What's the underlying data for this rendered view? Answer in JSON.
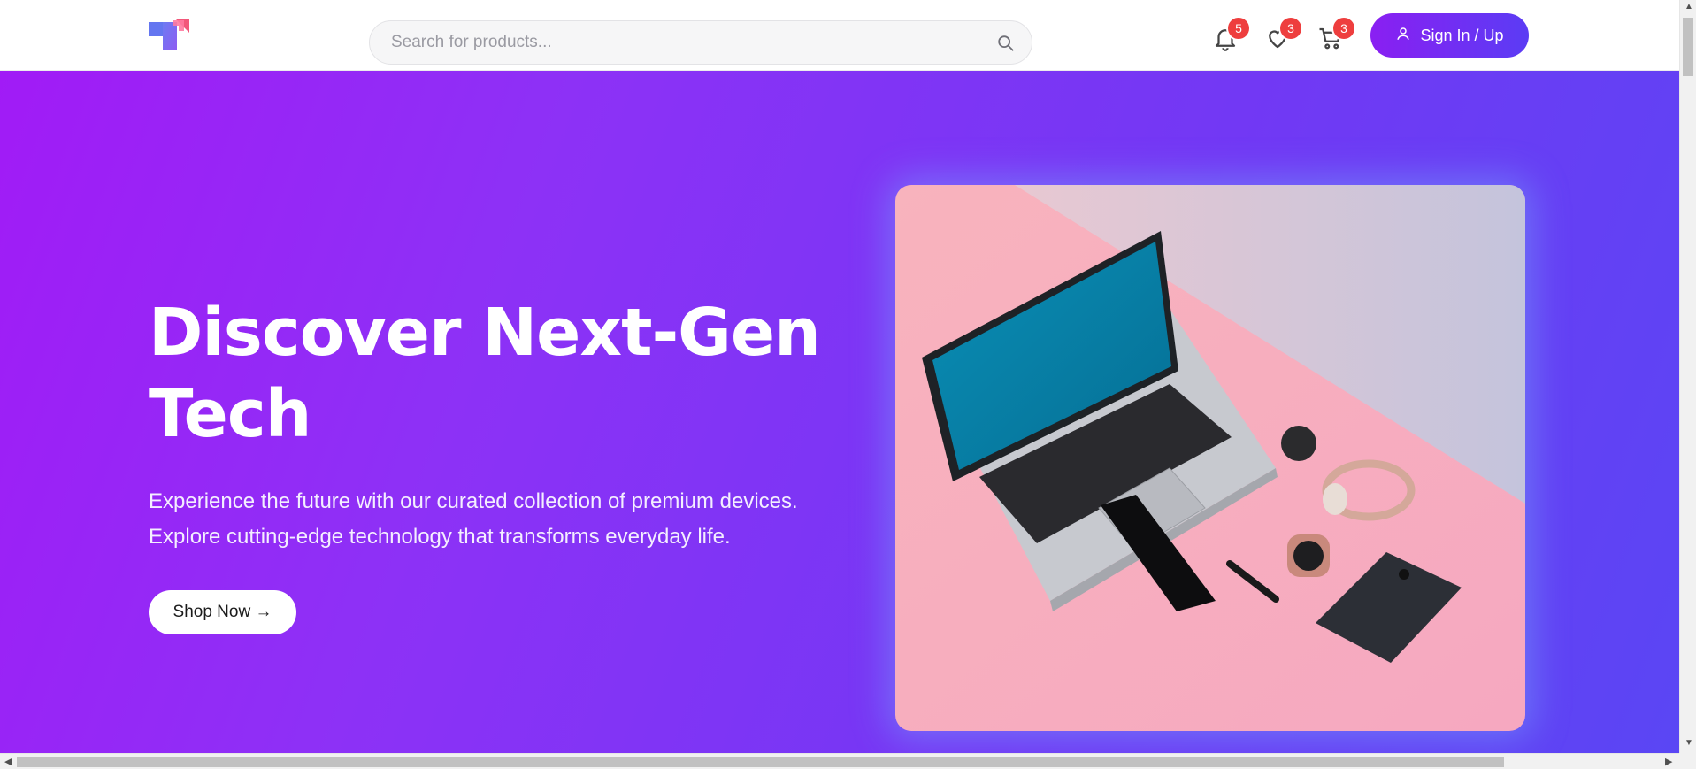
{
  "header": {
    "logo_icon": "brand-logo-icon",
    "search": {
      "placeholder": "Search for products...",
      "value": "",
      "icon": "search-icon"
    },
    "notifications": {
      "icon": "bell-icon",
      "count": "5"
    },
    "wishlist": {
      "icon": "heart-icon",
      "count": "3"
    },
    "cart": {
      "icon": "cart-icon",
      "count": "3"
    },
    "signin_label": "Sign In / Up",
    "signin_icon": "user-icon"
  },
  "hero": {
    "title": "Discover Next-Gen Tech",
    "description": "Experience the future with our curated collection of premium devices. Explore cutting-edge technology that transforms everyday life.",
    "cta_label": "Shop Now →",
    "image": "product-photo-laptop-phones-watch-headphones"
  },
  "colors": {
    "gradient_start": "#a11bf6",
    "gradient_end": "#5a46f4",
    "badge": "#ee3e3e",
    "signin_start": "#8a1ff2",
    "signin_end": "#5b3cf4"
  }
}
